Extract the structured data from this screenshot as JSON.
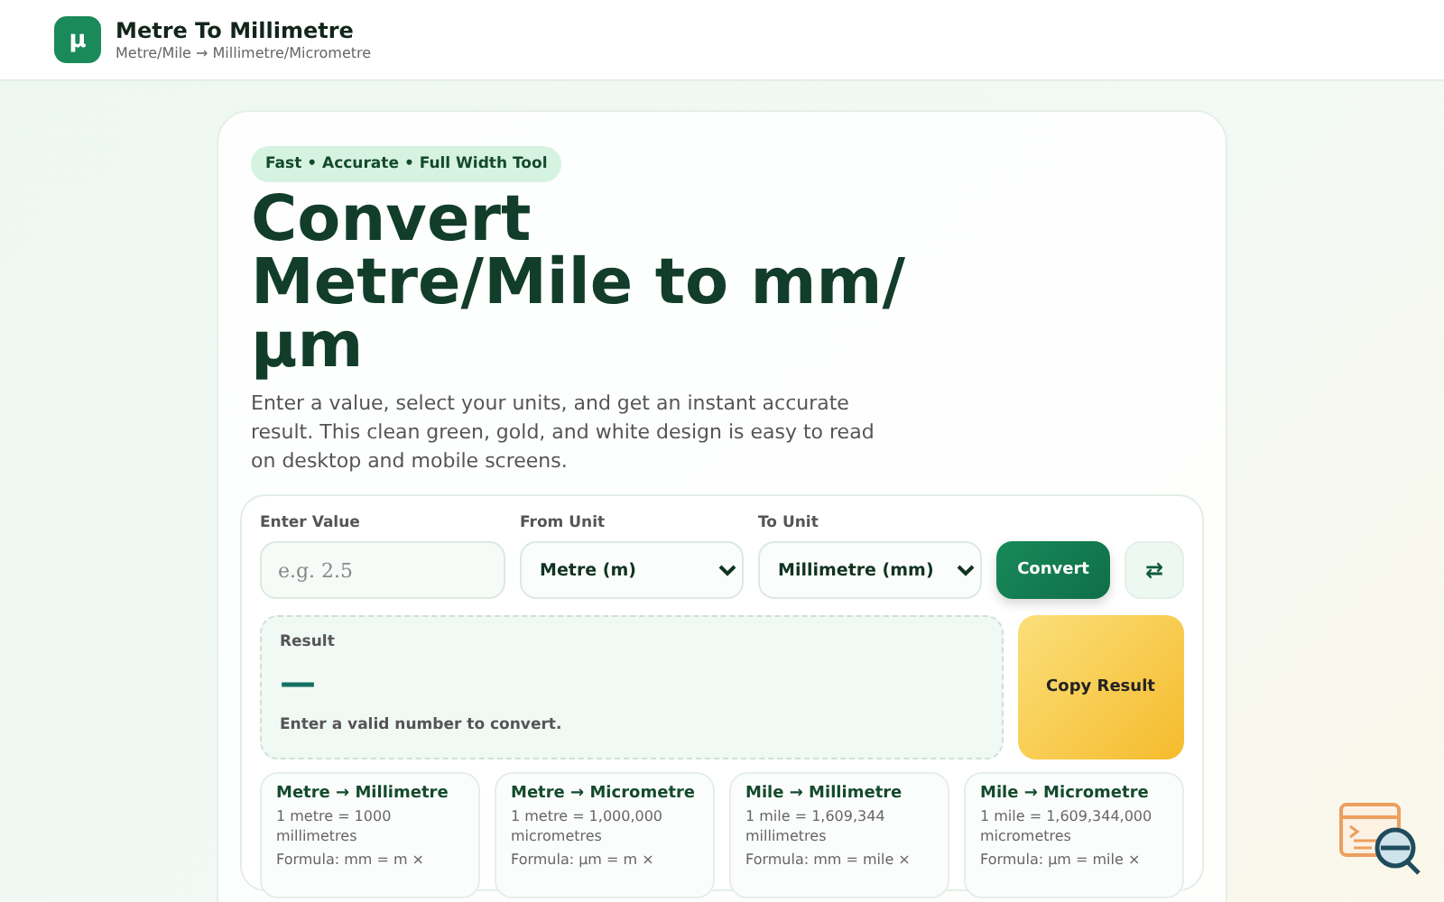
{
  "header": {
    "logo": "µ",
    "title": "Metre To Millimetre",
    "subtitle": "Metre/Mile → Millimetre/Micrometre"
  },
  "hero": {
    "badge": "Fast • Accurate • Full Width Tool",
    "title": "Convert Metre/Mile to mm/ µm",
    "description": "Enter a value, select your units, and get an instant accurate result. This clean green, gold, and white design is easy to read on desktop and mobile screens."
  },
  "form": {
    "value_label": "Enter Value",
    "value_placeholder": "e.g. 2.5",
    "from_label": "From Unit",
    "from_value": "Metre (m)",
    "to_label": "To Unit",
    "to_value": "Millimetre (mm)",
    "convert_button": "Convert",
    "swap_button": "⇄"
  },
  "result": {
    "label": "Result",
    "value": "—",
    "message": "Enter a valid number to convert.",
    "copy_button": "Copy Result"
  },
  "cards": [
    {
      "title": "Metre → Millimetre",
      "lines": [
        "1 metre = 1000 millimetres",
        "Formula: mm = m ×"
      ]
    },
    {
      "title": "Metre → Micrometre",
      "lines": [
        "1 metre = 1,000,000 micrometres",
        "Formula: µm = m ×"
      ]
    },
    {
      "title": "Mile → Millimetre",
      "lines": [
        "1 mile = 1,609,344 millimetres",
        "Formula: mm = mile ×"
      ]
    },
    {
      "title": "Mile → Micrometre",
      "lines": [
        "1 mile = 1,609,344,000 micrometres",
        "Formula: µm = mile ×"
      ]
    }
  ]
}
